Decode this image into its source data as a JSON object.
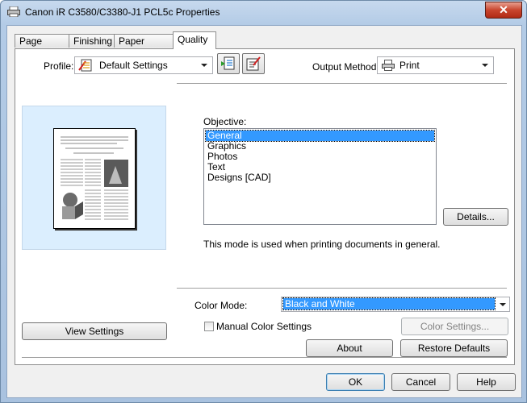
{
  "window": {
    "title": "Canon iR C3580/C3380-J1 PCL5c Properties",
    "close_glyph": "✕"
  },
  "tabs": [
    {
      "label": "Page Setup"
    },
    {
      "label": "Finishing"
    },
    {
      "label": "Paper Source"
    },
    {
      "label": "Quality"
    }
  ],
  "profile": {
    "label": "Profile:",
    "value": "Default Settings"
  },
  "output_method": {
    "label": "Output Method:",
    "value": "Print"
  },
  "objective": {
    "label": "Objective:",
    "items": [
      "General",
      "Graphics",
      "Photos",
      "Text",
      "Designs [CAD]"
    ],
    "selected": "General",
    "details_button": "Details...",
    "description": "This mode is used when printing documents in general."
  },
  "view_settings_button": "View Settings",
  "color_mode": {
    "label": "Color Mode:",
    "value": "Black and White"
  },
  "manual_color": {
    "label": "Manual Color Settings",
    "checked": false,
    "button": "Color Settings..."
  },
  "panel_buttons": {
    "about": "About",
    "restore": "Restore Defaults"
  },
  "dialog_buttons": {
    "ok": "OK",
    "cancel": "Cancel",
    "help": "Help"
  }
}
